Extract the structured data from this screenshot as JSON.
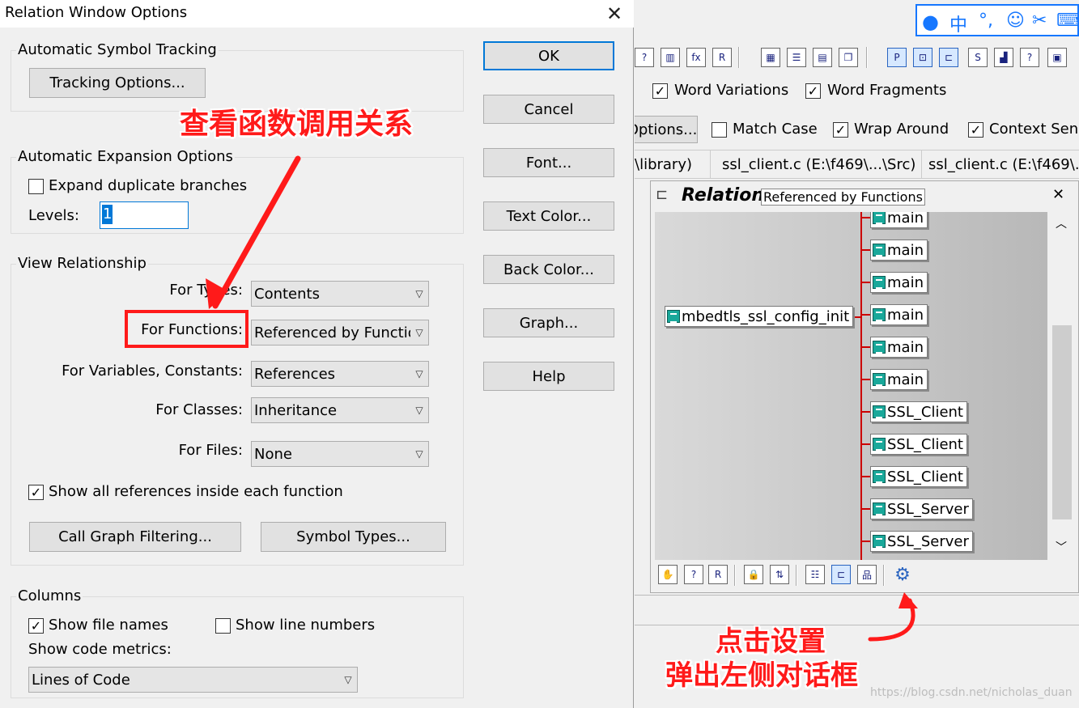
{
  "dialog": {
    "title": "Relation Window Options",
    "groups": {
      "tracking": {
        "title": "Automatic Symbol Tracking",
        "button": "Tracking Options..."
      },
      "expansion": {
        "title": "Automatic Expansion Options",
        "expand_duplicate_label": "Expand duplicate branches",
        "expand_duplicate_checked": false,
        "levels_label": "Levels:",
        "levels_value": "1"
      },
      "view": {
        "title": "View Relationship",
        "rows": [
          {
            "label": "For Types:",
            "value": "Contents"
          },
          {
            "label": "For Functions:",
            "value": "Referenced by Functions"
          },
          {
            "label": "For Variables, Constants:",
            "value": "References"
          },
          {
            "label": "For Classes:",
            "value": "Inheritance"
          },
          {
            "label": "For Files:",
            "value": "None"
          }
        ],
        "show_all_refs_label": "Show all references inside each function",
        "show_all_refs_checked": true,
        "call_graph_button": "Call Graph Filtering...",
        "symbol_types_button": "Symbol Types..."
      },
      "columns": {
        "title": "Columns",
        "show_file_names_label": "Show file names",
        "show_file_names_checked": true,
        "show_line_numbers_label": "Show line numbers",
        "show_line_numbers_checked": false,
        "code_metrics_label": "Show code metrics:",
        "code_metrics_value": "Lines of Code"
      }
    },
    "buttons": {
      "ok": "OK",
      "cancel": "Cancel",
      "font": "Font...",
      "text_color": "Text Color...",
      "back_color": "Back Color...",
      "graph": "Graph...",
      "help": "Help"
    }
  },
  "ide": {
    "search": {
      "word_variations": "Word Variations",
      "word_fragments": "Word Fragments",
      "options": "Options...",
      "match_case": "Match Case",
      "wrap_around": "Wrap Around",
      "context_sensitive": "Context Sens"
    },
    "tabs": [
      "\\library)",
      "ssl_client.c (E:\\f469\\...\\Src)",
      "ssl_client.c (E:\\f469\\..."
    ],
    "relation": {
      "title": "Relation",
      "mode": "Referenced by Functions",
      "root": "mbedtls_ssl_config_init",
      "callers": [
        "main",
        "main",
        "main",
        "main",
        "main",
        "main",
        "SSL_Client",
        "SSL_Client",
        "SSL_Client",
        "SSL_Server",
        "SSL_Server"
      ]
    },
    "ime_label": "中"
  },
  "annotations": {
    "view_call_relation": "查看函数调用关系",
    "click_settings_line1": "点击设置",
    "click_settings_line2": "弹出左侧对话框"
  },
  "watermark": "https://blog.csdn.net/nicholas_duan",
  "colors": {
    "annotation": "#ff1a1a",
    "accent": "#0078d7",
    "relation_line": "#cc0000"
  }
}
